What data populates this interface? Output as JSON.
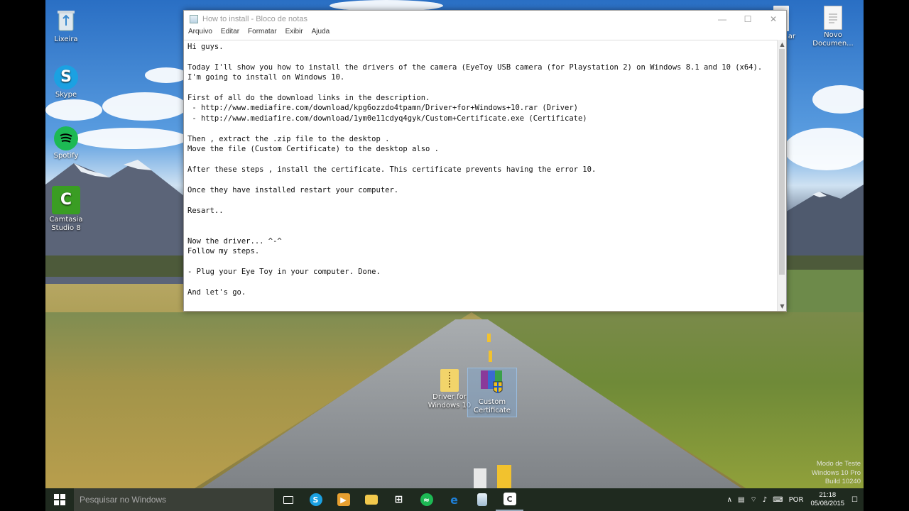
{
  "window": {
    "title": "How to install - Bloco de notas",
    "minimize": "—",
    "maximize": "☐",
    "close": "✕"
  },
  "menu": [
    "Arquivo",
    "Editar",
    "Formatar",
    "Exibir",
    "Ajuda"
  ],
  "document": {
    "lines": [
      "Hi guys.",
      "",
      "Today I'll show you how to install the drivers of the camera (EyeToy USB camera (for Playstation 2) on Windows 8.1 and 10 (x64).",
      "I'm going to install on Windows 10.",
      "",
      "First of all do the download links in the description.",
      " - http://www.mediafire.com/download/kpg6ozzdo4tpamn/Driver+for+Windows+10.rar (Driver)",
      " - http://www.mediafire.com/download/1ym0e11cdyq4gyk/Custom+Certificate.exe (Certificate)",
      "",
      "Then , extract the .zip file to the desktop .",
      "Move the file (Custom Certificate) to the desktop also .",
      "",
      "After these steps , install the certificate. This certificate prevents having the error 10.",
      "",
      "Once they have installed restart your computer.",
      "",
      "Resart..",
      "",
      "",
      "Now the driver... ^-^",
      "Follow my steps.",
      "",
      "- Plug your Eye Toy in your computer. Done.",
      "",
      "And let's go."
    ]
  },
  "desktop_icons": {
    "recycle": "Lixeira",
    "skype": "Skype",
    "spotify": "Spotify",
    "camtasia": "Camtasia\nStudio 8",
    "partial_right": "ar",
    "novo": "Novo\nDocumen...",
    "driver_folder": "Driver for\nWindows 10",
    "custom_cert": "Custom\nCertificate"
  },
  "watermark": {
    "line1": "Modo de Teste",
    "line2": "Windows 10 Pro",
    "line3": "Build 10240"
  },
  "taskbar": {
    "search_placeholder": "Pesquisar no Windows",
    "language": "POR",
    "time": "21:18",
    "date": "05/08/2015"
  },
  "colors": {
    "skype": "#1ba1e2",
    "spotify": "#1db954",
    "camtasia": "#3a9d23",
    "taskbar": "#1f2a1f"
  }
}
